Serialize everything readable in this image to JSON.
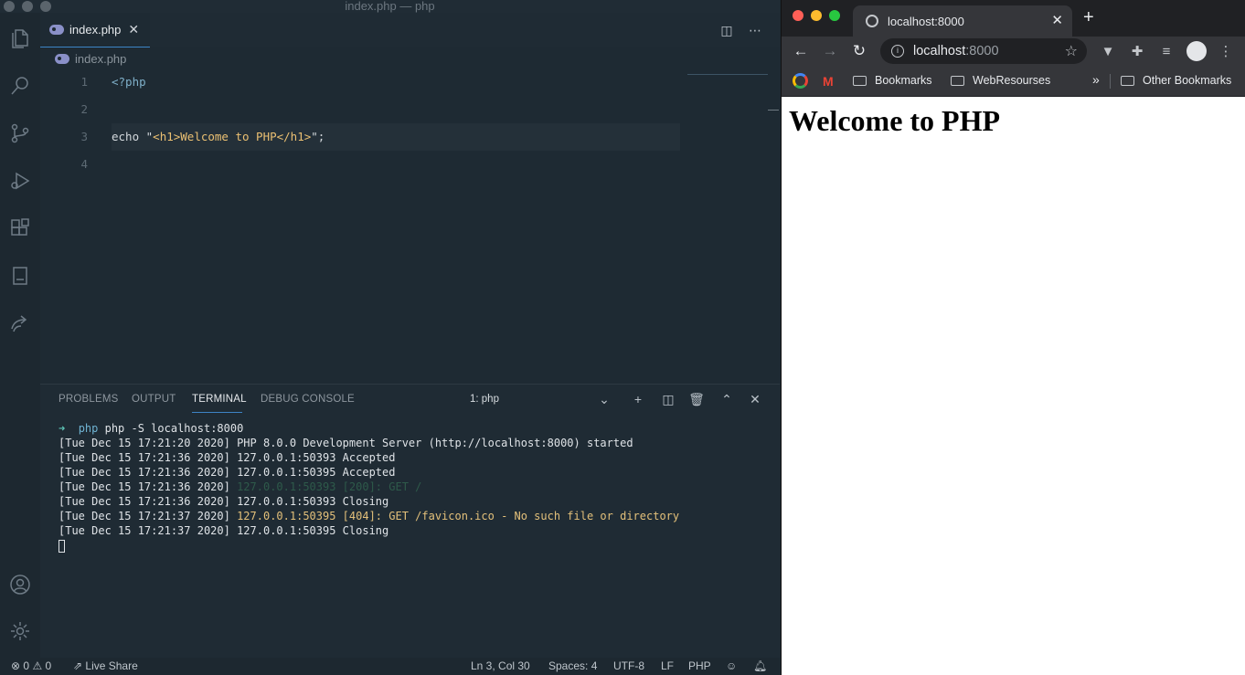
{
  "vscode": {
    "window_title": "index.php — php",
    "tab": {
      "filename": "index.php",
      "close_glyph": "✕"
    },
    "breadcrumb": "index.php",
    "editor": {
      "lines": [
        {
          "num": "1",
          "code": "<?php"
        },
        {
          "num": "2",
          "code": ""
        },
        {
          "num": "3",
          "code_keyword": "echo ",
          "code_q1": "\"",
          "code_string": "<h1>Welcome to PHP</h1>",
          "code_q2": "\"",
          "code_end": ";"
        },
        {
          "num": "4",
          "code": ""
        }
      ]
    },
    "panel": {
      "tabs": [
        "PROBLEMS",
        "OUTPUT",
        "TERMINAL",
        "DEBUG CONSOLE"
      ],
      "active_tab": "TERMINAL",
      "terminal_select": "1: php"
    },
    "terminal": {
      "prompt_arrow": "➜",
      "prompt_dir": "php",
      "command": "php -S localhost:8000",
      "lines": [
        {
          "ts": "[Tue Dec 15 17:21:20 2020]",
          "msg": "PHP 8.0.0 Development Server (http://localhost:8000) started"
        },
        {
          "ts": "[Tue Dec 15 17:21:36 2020]",
          "msg": "127.0.0.1:50393 Accepted"
        },
        {
          "ts": "[Tue Dec 15 17:21:36 2020]",
          "msg": "127.0.0.1:50395 Accepted"
        },
        {
          "ts": "[Tue Dec 15 17:21:36 2020]",
          "msg": "127.0.0.1:50393 [200]: GET /"
        },
        {
          "ts": "[Tue Dec 15 17:21:36 2020]",
          "msg": "127.0.0.1:50393 Closing"
        },
        {
          "ts": "[Tue Dec 15 17:21:37 2020]",
          "msg": "127.0.0.1:50395 [404]: GET /favicon.ico - No such file or directory"
        },
        {
          "ts": "[Tue Dec 15 17:21:37 2020]",
          "msg": "127.0.0.1:50395 Closing"
        }
      ]
    },
    "statusbar": {
      "errors": "0",
      "warnings": "0",
      "live_share": "Live Share",
      "position": "Ln 3, Col 30",
      "spaces": "Spaces: 4",
      "encoding": "UTF-8",
      "eol": "LF",
      "language": "PHP"
    },
    "icons": {
      "explorer": "files-icon",
      "search": "search-icon",
      "scm": "source-control-icon",
      "debug": "run-debug-icon",
      "extensions": "extensions-icon",
      "book": "book-icon",
      "live_share": "live-share-icon",
      "account": "account-icon",
      "settings": "gear-icon"
    }
  },
  "chrome": {
    "tab_title": "localhost:8000",
    "tab_close": "✕",
    "new_tab": "+",
    "url_host": "localhost",
    "url_port": ":8000",
    "bookmarks": {
      "items": [
        "Bookmarks",
        "WebResourses"
      ],
      "overflow": "»",
      "other": "Other Bookmarks"
    },
    "page": {
      "h1": "Welcome to PHP"
    }
  }
}
